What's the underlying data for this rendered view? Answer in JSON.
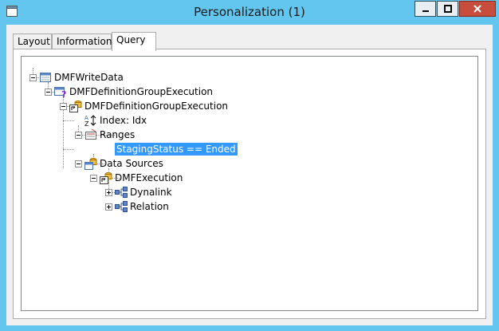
{
  "window": {
    "title": "Personalization (1)"
  },
  "tabs": [
    {
      "label": "Layout",
      "active": false
    },
    {
      "label": "Information",
      "active": false
    },
    {
      "label": "Query",
      "active": true
    }
  ],
  "tree": {
    "root": {
      "label": "DMFWriteData",
      "icon": "query-icon",
      "expanded": true,
      "child": {
        "label": "DMFDefinitionGroupExecution",
        "icon": "table-question-icon",
        "expanded": true,
        "child": {
          "label": "DMFDefinitionGroupExecution",
          "icon": "datasource-table-icon",
          "expanded": true,
          "index": {
            "label": "Index: Idx",
            "icon": "sort-index-icon"
          },
          "ranges": {
            "label": "Ranges",
            "icon": "ranges-icon",
            "expanded": true,
            "items": [
              {
                "label": "StagingStatus == Ended",
                "selected": true
              }
            ]
          },
          "data_sources": {
            "label": "Data Sources",
            "icon": "datasources-icon",
            "expanded": true,
            "child": {
              "label": "DMFExecution",
              "icon": "datasource-table-icon",
              "expanded": true,
              "children": [
                {
                  "label": "Dynalink",
                  "icon": "link-icon",
                  "expanded": false
                },
                {
                  "label": "Relation",
                  "icon": "link-icon",
                  "expanded": false
                }
              ]
            }
          }
        }
      }
    }
  },
  "colors": {
    "window_frame": "#63c6ee",
    "selection": "#3399ff",
    "close_button": "#c74e3c"
  }
}
